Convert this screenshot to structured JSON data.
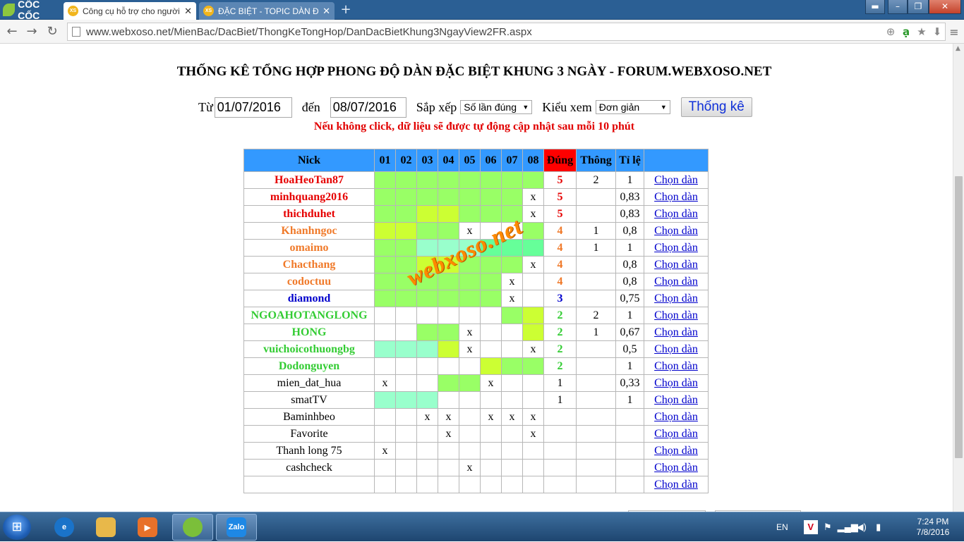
{
  "browser": {
    "brand": "CỐC CỐC",
    "tabs": [
      {
        "favicon": "XS",
        "title": "Công cụ hỗ trợ cho người",
        "close": "✕",
        "active": true
      },
      {
        "favicon": "XS",
        "title": "ĐẶC BIỆT - TOPIC DÀN ĐẶ",
        "close": "✕",
        "active": false
      }
    ],
    "new_tab": "+",
    "url": "www.webxoso.net/MienBac/DacBiet/ThongKeTongHop/DanDacBietKhung3NgayView2FR.aspx"
  },
  "page": {
    "title": "THỐNG KÊ TỔNG HỢP PHONG ĐỘ DÀN ĐẶC BIỆT KHUNG 3 NGÀY - FORUM.WEBXOSO.NET",
    "filters": {
      "from_label": "Từ",
      "from_value": "01/07/2016",
      "to_label": "đến",
      "to_value": "08/07/2016",
      "sort_label": "Sắp xếp",
      "sort_value": "Số lần đúng",
      "view_label": "Kiểu xem",
      "view_value": "Đơn giản",
      "submit": "Thống kê"
    },
    "notice": "Nếu không click, dữ liệu sẽ được tự động cập nhật sau mỗi 10 phút",
    "watermark": "webxoso.net"
  },
  "table": {
    "headers": [
      "Nick",
      "01",
      "02",
      "03",
      "04",
      "05",
      "06",
      "07",
      "08",
      "Đúng",
      "Thông",
      "Tỉ lệ",
      ""
    ],
    "link_label": "Chọn dàn",
    "colors": {
      "red": "#e60000",
      "orange": "#f07a2a",
      "blue": "#0000cc",
      "green": "#33cc33",
      "black": "#000000"
    },
    "rows": [
      {
        "nick": "HoaHeoTan87",
        "color": "red",
        "cells": [
          [
            "",
            "c1"
          ],
          [
            "",
            "c1"
          ],
          [
            "",
            "c1"
          ],
          [
            "",
            "c1"
          ],
          [
            "",
            "c1"
          ],
          [
            "",
            "c1"
          ],
          [
            "",
            "c1"
          ],
          [
            "",
            "c1"
          ]
        ],
        "dung": "5",
        "thong": "2",
        "tile": "1"
      },
      {
        "nick": "minhquang2016",
        "color": "red",
        "cells": [
          [
            "",
            "c1"
          ],
          [
            "",
            "c1"
          ],
          [
            "",
            "c1"
          ],
          [
            "",
            "c1"
          ],
          [
            "",
            "c1"
          ],
          [
            "",
            "c1"
          ],
          [
            "",
            "c1"
          ],
          [
            "x",
            ""
          ]
        ],
        "dung": "5",
        "thong": "",
        "tile": "0,83"
      },
      {
        "nick": "thichduhet",
        "color": "red",
        "cells": [
          [
            "",
            "c1"
          ],
          [
            "",
            "c1"
          ],
          [
            "",
            "c2"
          ],
          [
            "",
            "c2"
          ],
          [
            "",
            "c1"
          ],
          [
            "",
            "c1"
          ],
          [
            "",
            "c1"
          ],
          [
            "x",
            ""
          ]
        ],
        "dung": "5",
        "thong": "",
        "tile": "0,83"
      },
      {
        "nick": "Khanhngoc",
        "color": "orange",
        "cells": [
          [
            "",
            "c2"
          ],
          [
            "",
            "c2"
          ],
          [
            "",
            "c1"
          ],
          [
            "",
            "c1"
          ],
          [
            "x",
            ""
          ],
          [
            "",
            ""
          ],
          [
            "",
            ""
          ],
          [
            "",
            "c1"
          ]
        ],
        "dung": "4",
        "thong": "1",
        "tile": "0,8"
      },
      {
        "nick": "omaimo",
        "color": "orange",
        "cells": [
          [
            "",
            "c1"
          ],
          [
            "",
            "c1"
          ],
          [
            "",
            "c3"
          ],
          [
            "",
            "c3"
          ],
          [
            "",
            "c3"
          ],
          [
            "",
            "c4"
          ],
          [
            "",
            "c4"
          ],
          [
            "",
            "c4"
          ]
        ],
        "dung": "4",
        "thong": "1",
        "tile": "1"
      },
      {
        "nick": "Chacthang",
        "color": "orange",
        "cells": [
          [
            "",
            "c1"
          ],
          [
            "",
            "c1"
          ],
          [
            "",
            "c2"
          ],
          [
            "",
            "c2"
          ],
          [
            "",
            "c1"
          ],
          [
            "",
            "c1"
          ],
          [
            "",
            "c1"
          ],
          [
            "x",
            ""
          ]
        ],
        "dung": "4",
        "thong": "",
        "tile": "0,8"
      },
      {
        "nick": "codoctuu",
        "color": "orange",
        "cells": [
          [
            "",
            "c1"
          ],
          [
            "",
            "c1"
          ],
          [
            "",
            "c1"
          ],
          [
            "",
            "c1"
          ],
          [
            "",
            "c1"
          ],
          [
            "",
            "c1"
          ],
          [
            "x",
            ""
          ],
          [
            "",
            ""
          ]
        ],
        "dung": "4",
        "thong": "",
        "tile": "0,8"
      },
      {
        "nick": "diamond",
        "color": "blue",
        "cells": [
          [
            "",
            "c1"
          ],
          [
            "",
            "c1"
          ],
          [
            "",
            "c1"
          ],
          [
            "",
            "c1"
          ],
          [
            "",
            "c1"
          ],
          [
            "",
            "c1"
          ],
          [
            "x",
            ""
          ],
          [
            "",
            ""
          ]
        ],
        "dung": "3",
        "thong": "",
        "tile": "0,75"
      },
      {
        "nick": "NGOAHOTANGLONG",
        "color": "green",
        "cells": [
          [
            "",
            ""
          ],
          [
            "",
            ""
          ],
          [
            "",
            ""
          ],
          [
            "",
            ""
          ],
          [
            "",
            ""
          ],
          [
            "",
            ""
          ],
          [
            "",
            "c1"
          ],
          [
            "",
            "c2"
          ]
        ],
        "dung": "2",
        "thong": "2",
        "tile": "1"
      },
      {
        "nick": "HONG",
        "color": "green",
        "cells": [
          [
            "",
            ""
          ],
          [
            "",
            ""
          ],
          [
            "",
            "c1"
          ],
          [
            "",
            "c1"
          ],
          [
            "x",
            ""
          ],
          [
            "",
            ""
          ],
          [
            "",
            ""
          ],
          [
            "",
            "c2"
          ]
        ],
        "dung": "2",
        "thong": "1",
        "tile": "0,67"
      },
      {
        "nick": "vuichoicothuongbg",
        "color": "green",
        "cells": [
          [
            "",
            "c3"
          ],
          [
            "",
            "c3"
          ],
          [
            "",
            "c3"
          ],
          [
            "",
            "c2"
          ],
          [
            "x",
            ""
          ],
          [
            "",
            ""
          ],
          [
            "",
            ""
          ],
          [
            "x",
            ""
          ]
        ],
        "dung": "2",
        "thong": "",
        "tile": "0,5"
      },
      {
        "nick": "Dodonguyen",
        "color": "green",
        "cells": [
          [
            "",
            ""
          ],
          [
            "",
            ""
          ],
          [
            "",
            ""
          ],
          [
            "",
            ""
          ],
          [
            "",
            ""
          ],
          [
            "",
            "c2"
          ],
          [
            "",
            "c1"
          ],
          [
            "",
            "c1"
          ]
        ],
        "dung": "2",
        "thong": "",
        "tile": "1"
      },
      {
        "nick": "mien_dat_hua",
        "color": "black",
        "cells": [
          [
            "x",
            ""
          ],
          [
            "",
            ""
          ],
          [
            "",
            ""
          ],
          [
            "",
            "c1"
          ],
          [
            "",
            "c1"
          ],
          [
            "x",
            ""
          ],
          [
            "",
            ""
          ],
          [
            "",
            ""
          ]
        ],
        "dung": "1",
        "thong": "",
        "tile": "0,33"
      },
      {
        "nick": "smatTV",
        "color": "black",
        "cells": [
          [
            "",
            "c3"
          ],
          [
            "",
            "c3"
          ],
          [
            "",
            "c3"
          ],
          [
            "",
            ""
          ],
          [
            "",
            ""
          ],
          [
            "",
            ""
          ],
          [
            "",
            ""
          ],
          [
            "",
            ""
          ]
        ],
        "dung": "1",
        "thong": "",
        "tile": "1"
      },
      {
        "nick": "Baminhbeo",
        "color": "black",
        "cells": [
          [
            "",
            ""
          ],
          [
            "",
            ""
          ],
          [
            "x",
            ""
          ],
          [
            "x",
            ""
          ],
          [
            "",
            ""
          ],
          [
            "x",
            ""
          ],
          [
            "x",
            ""
          ],
          [
            "x",
            ""
          ]
        ],
        "dung": "",
        "thong": "",
        "tile": ""
      },
      {
        "nick": "Favorite",
        "color": "black",
        "cells": [
          [
            "",
            ""
          ],
          [
            "",
            ""
          ],
          [
            "",
            ""
          ],
          [
            "x",
            ""
          ],
          [
            "",
            ""
          ],
          [
            "",
            ""
          ],
          [
            "",
            ""
          ],
          [
            "x",
            ""
          ]
        ],
        "dung": "",
        "thong": "",
        "tile": ""
      },
      {
        "nick": "Thanh long 75",
        "color": "black",
        "cells": [
          [
            "x",
            ""
          ],
          [
            "",
            ""
          ],
          [
            "",
            ""
          ],
          [
            "",
            ""
          ],
          [
            "",
            ""
          ],
          [
            "",
            ""
          ],
          [
            "",
            ""
          ],
          [
            "",
            ""
          ]
        ],
        "dung": "",
        "thong": "",
        "tile": ""
      },
      {
        "nick": "cashcheck",
        "color": "black",
        "cells": [
          [
            "",
            ""
          ],
          [
            "",
            ""
          ],
          [
            "",
            ""
          ],
          [
            "",
            ""
          ],
          [
            "x",
            ""
          ],
          [
            "",
            ""
          ],
          [
            "",
            ""
          ],
          [
            "",
            ""
          ]
        ],
        "dung": "",
        "thong": "",
        "tile": ""
      },
      {
        "nick": "",
        "color": "black",
        "cells": [
          [
            "",
            ""
          ],
          [
            "",
            ""
          ],
          [
            "",
            ""
          ],
          [
            "",
            ""
          ],
          [
            "",
            ""
          ],
          [
            "",
            ""
          ],
          [
            "",
            ""
          ],
          [
            "",
            ""
          ]
        ],
        "dung": "",
        "thong": "",
        "tile": ""
      }
    ]
  },
  "taskbar": {
    "apps": [
      {
        "name": "ie-icon",
        "glyph": "e",
        "color": "#1a73c9"
      },
      {
        "name": "explorer-icon",
        "glyph": "",
        "color": "#e8b84a"
      },
      {
        "name": "media-player-icon",
        "glyph": "▶",
        "color": "#e8712a"
      },
      {
        "name": "coccoc-icon",
        "glyph": "",
        "color": "#7bbf3a"
      },
      {
        "name": "zalo-icon",
        "glyph": "Zalo",
        "color": "#1e88e5"
      }
    ],
    "language": "EN",
    "time": "7:24 PM",
    "date": "7/8/2016"
  }
}
